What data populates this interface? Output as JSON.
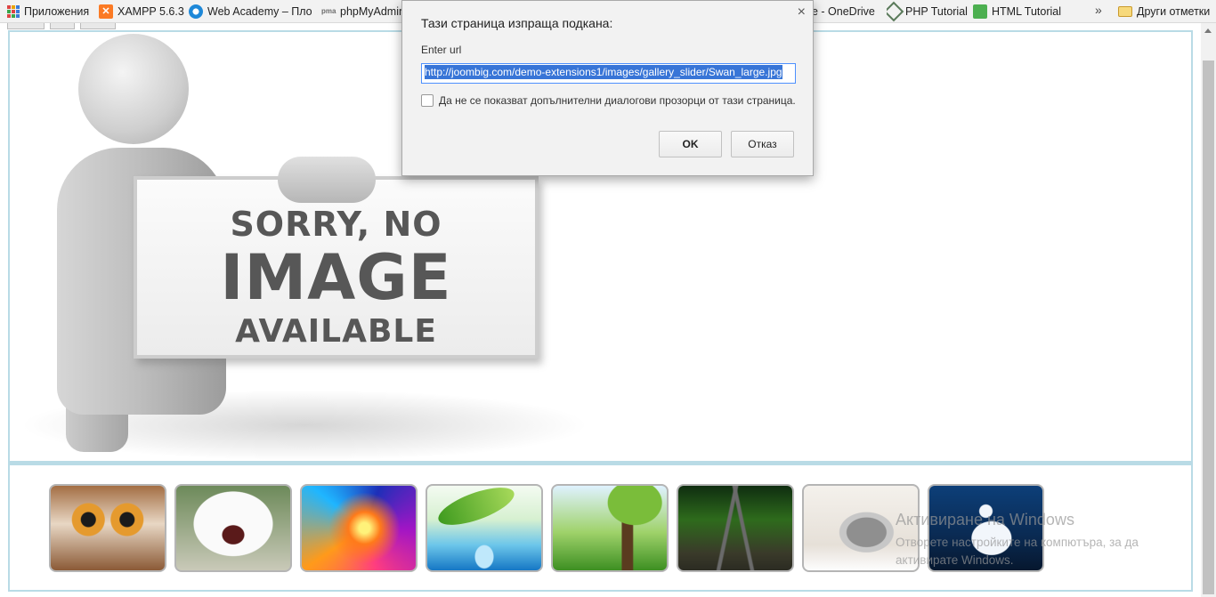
{
  "bookmarks": {
    "apps": "Приложения",
    "xampp": "XAMPP 5.6.3",
    "webacademy": "Web Academy – Пло",
    "phpmyadmin": "phpMyAdmin",
    "onedrive": "e - OneDrive",
    "php_tutorial": "PHP Tutorial",
    "html_tutorial": "HTML Tutorial",
    "overflow": "»",
    "other": "Други отметки"
  },
  "placeholder": {
    "line1": "SORRY, NO",
    "line2": "IMAGE",
    "line3": "AVAILABLE"
  },
  "thumbnails": [
    "owl",
    "snowy-owl",
    "abstract",
    "water-leaf",
    "forest",
    "railway",
    "kitten",
    "swan"
  ],
  "dialog": {
    "title": "Тази страница изпраща подкана:",
    "message": "Enter url",
    "input_value": "http://joombig.com/demo-extensions1/images/gallery_slider/Swan_large.jpg",
    "checkbox_label": "Да не се показват допълнителни диалогови прозорци от тази страница.",
    "ok": "OK",
    "cancel": "Отказ",
    "close": "×"
  },
  "watermark": {
    "title": "Активиране на Windows",
    "line1": "Отворете настройките на компютъра, за да",
    "line2": "активирате Windows."
  }
}
